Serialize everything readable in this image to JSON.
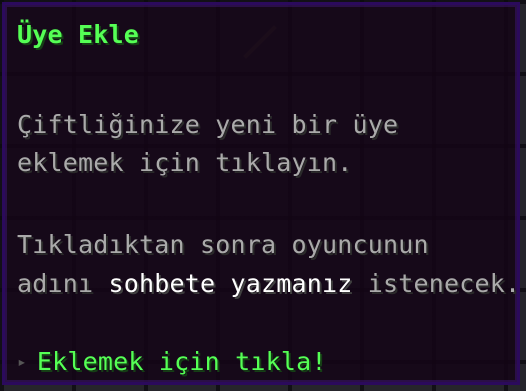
{
  "tooltip": {
    "title": "Üye Ekle",
    "description_lines": [
      "Çiftliğinize yeni bir üye",
      "eklemek için tıklayın."
    ],
    "info_line1": "Tıkladıktan sonra oyuncunun",
    "info_line2_before": "adını ",
    "info_line2_highlight": "sohbete yazmanız",
    "info_line2_after": " istenecek.",
    "action_arrow": "▸",
    "action_text": "Eklemek için tıkla!"
  },
  "colors": {
    "title": "#55ff55",
    "description": "#aaaaaa",
    "highlight": "#ffffff",
    "action": "#55ff55",
    "border": "#2b0a5c",
    "background": "#130416"
  }
}
